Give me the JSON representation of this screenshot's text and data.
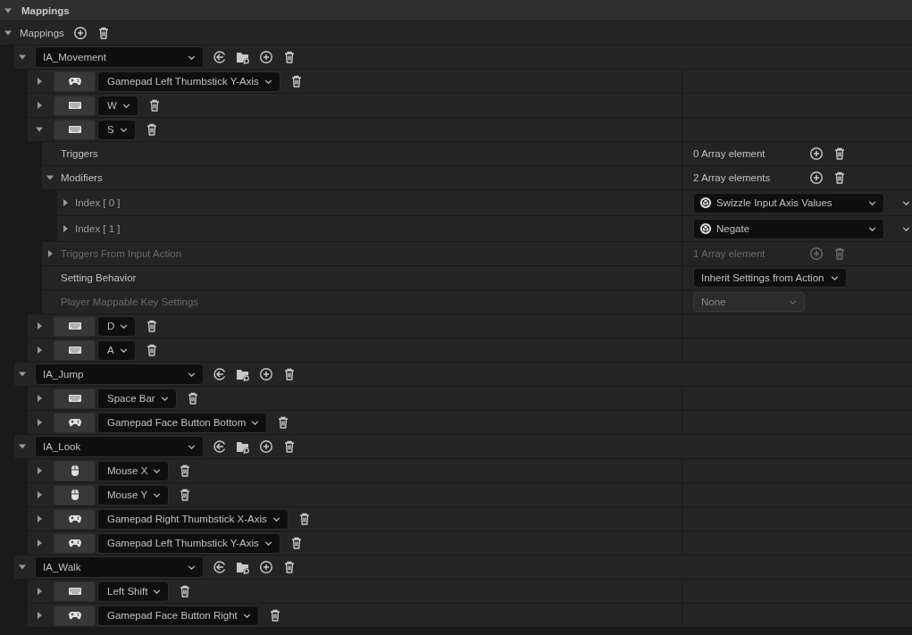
{
  "header": {
    "title": "Mappings",
    "expanded": true
  },
  "mappings": {
    "label": "Mappings",
    "expanded": true
  },
  "actions": [
    {
      "name": "IA_Movement",
      "expanded": true,
      "keys": [
        {
          "kind": "gamepad",
          "key": "Gamepad Left Thumbstick Y-Axis",
          "expanded": false
        },
        {
          "kind": "keyboard",
          "key": "W",
          "expanded": false
        },
        {
          "kind": "keyboard",
          "key": "S",
          "expanded": true,
          "details": [
            {
              "kind": "array",
              "label": "Triggers",
              "count": "0 Array element",
              "disabled": false
            },
            {
              "kind": "array",
              "label": "Modifiers",
              "count": "2 Array elements",
              "disabled": false,
              "expanded": true,
              "elements": [
                {
                  "label": "Index [ 0 ]",
                  "value": "Swizzle Input Axis Values",
                  "expanded": false
                },
                {
                  "label": "Index [ 1 ]",
                  "value": "Negate",
                  "expanded": false
                }
              ]
            },
            {
              "kind": "array",
              "label": "Triggers From Input Action",
              "count": "1 Array element",
              "disabled": true,
              "expanded": false
            },
            {
              "kind": "dropdown",
              "label": "Setting Behavior",
              "value": "Inherit Settings from Action",
              "disabled": false
            },
            {
              "kind": "dropdown",
              "label": "Player Mappable Key Settings",
              "value": "None",
              "disabled": true
            }
          ]
        },
        {
          "kind": "keyboard",
          "key": "D",
          "expanded": false
        },
        {
          "kind": "keyboard",
          "key": "A",
          "expanded": false
        }
      ]
    },
    {
      "name": "IA_Jump",
      "expanded": true,
      "keys": [
        {
          "kind": "keyboard",
          "key": "Space Bar",
          "expanded": false
        },
        {
          "kind": "gamepad",
          "key": "Gamepad Face Button Bottom",
          "expanded": false
        }
      ]
    },
    {
      "name": "IA_Look",
      "expanded": true,
      "keys": [
        {
          "kind": "mouse",
          "key": "Mouse X",
          "expanded": false
        },
        {
          "kind": "mouse",
          "key": "Mouse Y",
          "expanded": false
        },
        {
          "kind": "gamepad",
          "key": "Gamepad Right Thumbstick X-Axis",
          "expanded": false
        },
        {
          "kind": "gamepad",
          "key": "Gamepad Left Thumbstick Y-Axis",
          "expanded": false
        }
      ]
    },
    {
      "name": "IA_Walk",
      "expanded": true,
      "keys": [
        {
          "kind": "keyboard",
          "key": "Left Shift",
          "expanded": false
        },
        {
          "kind": "gamepad",
          "key": "Gamepad Face Button Right",
          "expanded": false
        }
      ]
    }
  ]
}
